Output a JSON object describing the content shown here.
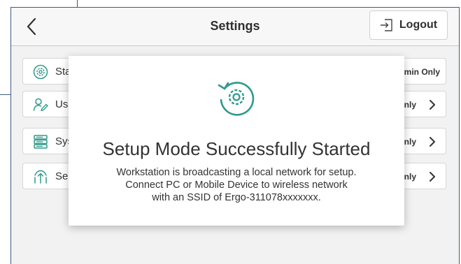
{
  "header": {
    "title": "Settings",
    "logout_label": "Logout"
  },
  "rows": [
    {
      "label": "Sta",
      "badge": "dmin Only",
      "icon": "gear-badge-icon",
      "has_chevron": false
    },
    {
      "label": "Us",
      "badge": "Only",
      "icon": "user-edit-icon",
      "has_chevron": true
    },
    {
      "label": "Sys",
      "badge": "Only",
      "icon": "server-icon",
      "has_chevron": true
    },
    {
      "label": "Se",
      "badge": "Only",
      "icon": "network-upload-icon",
      "has_chevron": true
    }
  ],
  "modal": {
    "icon": "gear-refresh-icon",
    "title": "Setup Mode Successfully Started",
    "line1": "Workstation is broadcasting a local network for setup.",
    "line2": "Connect PC or Mobile Device to wireless network",
    "line3": "with an SSID of Ergo-311078xxxxxxx."
  },
  "colors": {
    "accent": "#2e9a8a",
    "frame_border": "#3e5a80",
    "text": "#333333"
  }
}
